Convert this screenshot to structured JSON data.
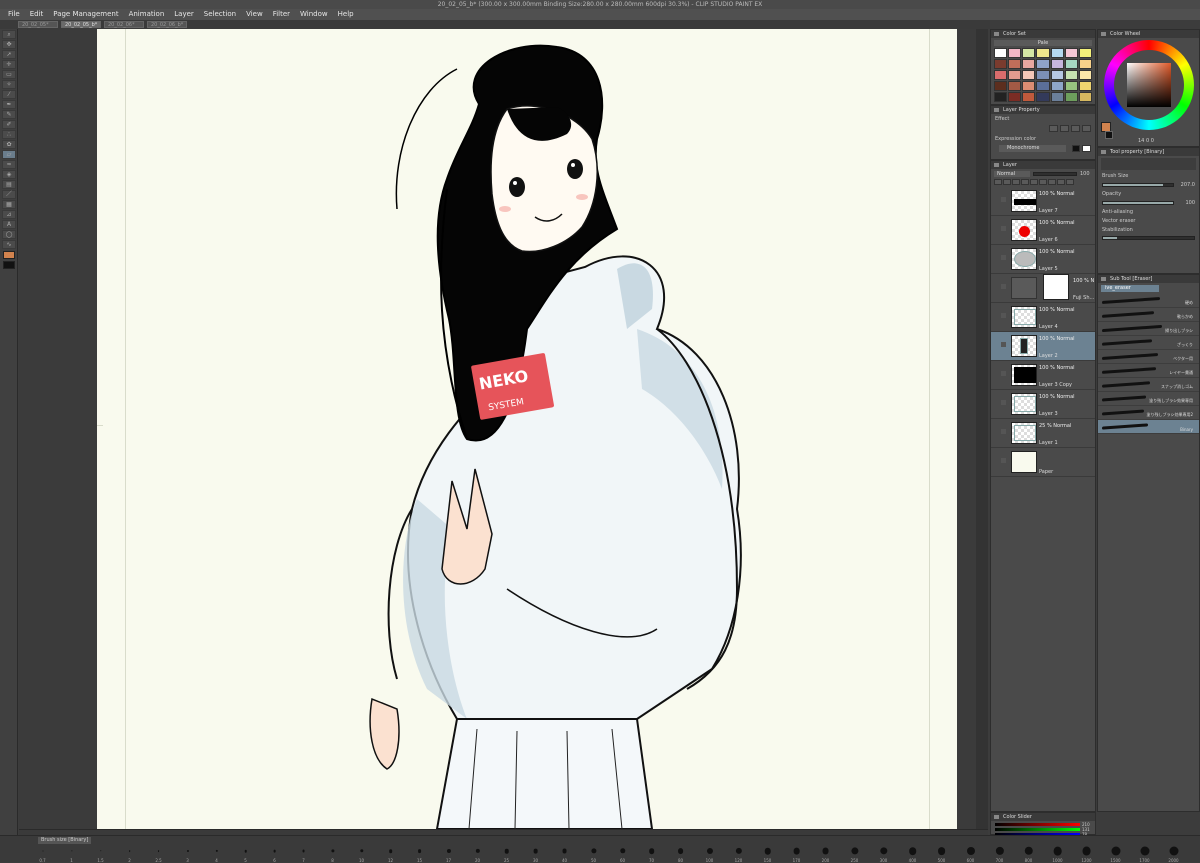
{
  "window": {
    "title": "20_02_05_b* (300.00 x 300.00mm Binding Size:280.00 x 280.00mm 600dpi 30.3%) - CLIP STUDIO PAINT EX"
  },
  "menu": [
    "File",
    "Edit",
    "Page Management",
    "Animation",
    "Layer",
    "Selection",
    "View",
    "Filter",
    "Window",
    "Help"
  ],
  "doc_tabs": [
    "20_02_05*",
    "20_02_05_b*",
    "20_02_06*",
    "20_02_06_b*"
  ],
  "artwork": {
    "shirt_text_1": "NEKO",
    "shirt_text_2": "SYSTEM"
  },
  "panels": {
    "color_set": {
      "title": "Color Set",
      "dropdown": "Pale"
    },
    "color_wheel": {
      "title": "Color Wheel",
      "main_color": "#d2834e",
      "sub_color": "#111111",
      "readout": "14 0 0"
    },
    "layer_property": {
      "title": "Layer Property",
      "effect": "Effect",
      "expression_label": "Expression color",
      "expression_value": "Monochrome"
    },
    "tool_property": {
      "title": "Tool property [Binary]",
      "brush_size_label": "Brush Size",
      "brush_size": "207.0",
      "opacity_label": "Opacity",
      "opacity": "100",
      "anti_alias_label": "Anti-aliasing",
      "vector_eraser_label": "Vector eraser",
      "stabilization_label": "Stabilization"
    },
    "layer": {
      "title": "Layer",
      "blend_mode": "Normal",
      "opacity": "100",
      "layers": [
        {
          "mode": "100 % Normal",
          "name": "Layer 7",
          "thumb": "sunglasses"
        },
        {
          "mode": "100 % Normal",
          "name": "Layer 6",
          "thumb": "red-dot"
        },
        {
          "mode": "100 % Normal",
          "name": "Layer 5",
          "thumb": "glow"
        },
        {
          "mode": "100 % N",
          "name": "Fuji Sh...",
          "thumb": "folder"
        },
        {
          "mode": "100 % Normal",
          "name": "Layer 4",
          "thumb": "sketch"
        },
        {
          "mode": "100 % Normal",
          "name": "Layer 2",
          "thumb": "figure"
        },
        {
          "mode": "100 % Normal",
          "name": "Layer 3 Copy",
          "thumb": "figure-dark"
        },
        {
          "mode": "100 % Normal",
          "name": "Layer 3",
          "thumb": "sketch"
        },
        {
          "mode": "25 % Normal",
          "name": "Layer 1",
          "thumb": "sketch-blue"
        },
        {
          "mode": "",
          "name": "Paper",
          "thumb": "paper"
        }
      ]
    },
    "sub_tool": {
      "title": "Sub Tool [Eraser]",
      "group": "ive_eraser",
      "items": [
        "硬め",
        "軟らかめ",
        "掃り出しブラシ",
        "ざっくり",
        "ベクター用",
        "レイヤー貫通",
        "スナップ消しゴム",
        "塗り残しブラシ効果専用",
        "塗り残しブラシ効果専用2",
        "Binary"
      ]
    },
    "color_slider": {
      "title": "Color Slider",
      "r": "210",
      "g": "131",
      "b": "78"
    }
  },
  "brush_size_palette": {
    "header": "Brush size [Binary]",
    "sizes": [
      "0.7",
      "1",
      "1.5",
      "2",
      "2.5",
      "3",
      "4",
      "5",
      "6",
      "7",
      "8",
      "10",
      "12",
      "15",
      "17",
      "20",
      "25",
      "30",
      "40",
      "50",
      "60",
      "70",
      "80",
      "100",
      "120",
      "150",
      "170",
      "200",
      "250",
      "300",
      "400",
      "500",
      "600",
      "700",
      "800",
      "1000",
      "1200",
      "1500",
      "1700",
      "2000"
    ]
  },
  "colors": {
    "palette": [
      "#ffffff",
      "#f2b8c6",
      "#d4e6a5",
      "#f0e68c",
      "#b5d8ef",
      "#f6c6d6",
      "#f3f07a",
      "#7a3b2e",
      "#c06e5a",
      "#e8a7a0",
      "#8fa3c9",
      "#c7b5de",
      "#a6d7c2",
      "#f7d08a",
      "#d96c6c",
      "#e19b8f",
      "#f4c7b7",
      "#7b8fb5",
      "#b6c8e3",
      "#c6e3b1",
      "#fbe7a9",
      "#5c2e1e",
      "#a35a45",
      "#dc8d73",
      "#5b6f99",
      "#8ea6c9",
      "#97c47f",
      "#eed46f",
      "#222222",
      "#7a2c24",
      "#c05a3c",
      "#333a5a",
      "#6b7f9a",
      "#6d9e5c",
      "#d6b85f"
    ]
  }
}
